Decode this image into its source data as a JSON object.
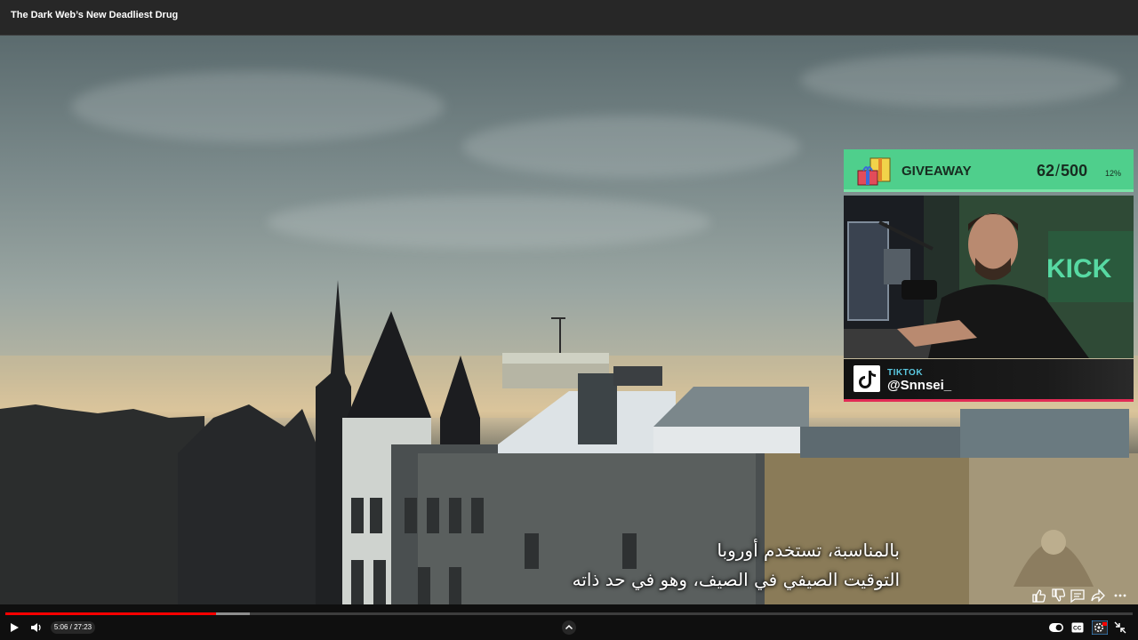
{
  "window": {
    "title": "The Dark Web’s New Deadliest Drug"
  },
  "subtitles": {
    "line1": "بالمناسبة، تستخدم أوروبا",
    "line2": "التوقيت الصيفي في الصيف، وهو في حد ذاته"
  },
  "overlay": {
    "giveaway": {
      "label": "GIVEAWAY",
      "current": "62",
      "separator": "/",
      "total": "500",
      "percent": "12%",
      "accent": "#4fcf8c"
    },
    "social": {
      "platform": "TIKTOK",
      "handle": "@Snnsei_",
      "accent": "#e12b55"
    }
  },
  "actions": {
    "icons": [
      "like-icon",
      "dislike-icon",
      "comment-icon",
      "share-icon",
      "more-icon"
    ]
  },
  "player": {
    "time_display": "5:06 / 27:23",
    "progress_played": 0.187,
    "progress_buffered": 0.217,
    "progress_color": "#ff0000",
    "icons": [
      "play-icon",
      "volume-icon",
      "chevron-up-icon",
      "autoplay-toggle-icon",
      "captions-icon",
      "settings-icon",
      "exit-fullscreen-icon"
    ]
  }
}
